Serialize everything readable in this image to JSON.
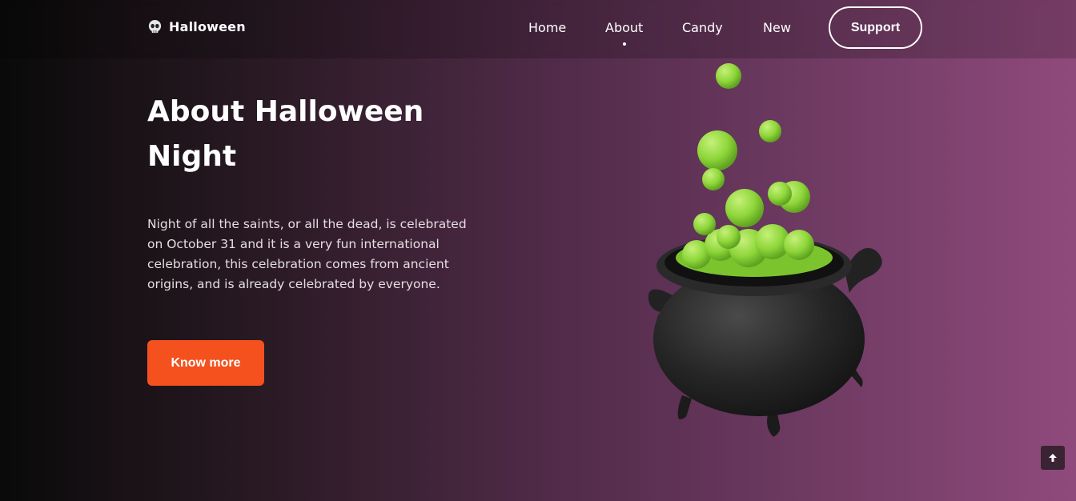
{
  "header": {
    "brand": "Halloween",
    "nav": [
      {
        "label": "Home"
      },
      {
        "label": "About"
      },
      {
        "label": "Candy"
      },
      {
        "label": "New"
      }
    ],
    "active": "About",
    "support_label": "Support"
  },
  "hero": {
    "title": "About Halloween Night",
    "description": "Night of all the saints, or all the dead, is celebrated on October 31 and it is a very fun international celebration, this celebration comes from ancient origins, and is already celebrated by everyone.",
    "cta_label": "Know more"
  },
  "icons": {
    "logo": "skull-icon",
    "illustration": "cauldron-icon",
    "scroll_top": "arrow-up-icon"
  },
  "colors": {
    "accent": "#f4511e",
    "gradient_start": "#0a0a0a",
    "gradient_end": "#8f4a7c",
    "bubble": "#8ed63a"
  }
}
